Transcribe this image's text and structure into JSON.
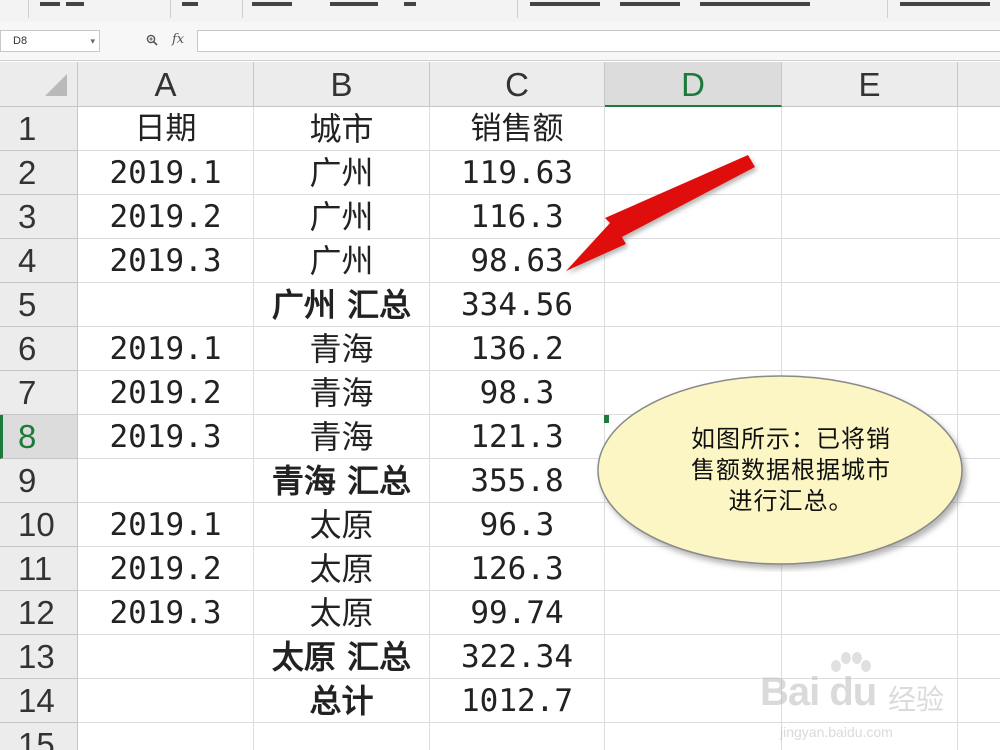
{
  "formula_bar": {
    "name_box": "D8",
    "fx": "fx",
    "formula": ""
  },
  "columns": [
    "A",
    "B",
    "C",
    "D",
    "E"
  ],
  "active_column": "D",
  "active_row": 8,
  "rows": [
    {
      "num": "1",
      "a": "日期",
      "b": "城市",
      "c": "销售额",
      "b_style": "city"
    },
    {
      "num": "2",
      "a": "2019.1",
      "b": "广州",
      "c": "119.63",
      "b_style": "city"
    },
    {
      "num": "3",
      "a": "2019.2",
      "b": "广州",
      "c": "116.3",
      "b_style": "city"
    },
    {
      "num": "4",
      "a": "2019.3",
      "b": "广州",
      "c": "98.63",
      "b_style": "city"
    },
    {
      "num": "5",
      "a": "",
      "b": "广州 汇总",
      "c": "334.56",
      "b_style": "subtotal"
    },
    {
      "num": "6",
      "a": "2019.1",
      "b": "青海",
      "c": "136.2",
      "b_style": "city"
    },
    {
      "num": "7",
      "a": "2019.2",
      "b": "青海",
      "c": "98.3",
      "b_style": "city"
    },
    {
      "num": "8",
      "a": "2019.3",
      "b": "青海",
      "c": "121.3",
      "b_style": "city"
    },
    {
      "num": "9",
      "a": "",
      "b": "青海 汇总",
      "c": "355.8",
      "b_style": "subtotal"
    },
    {
      "num": "10",
      "a": "2019.1",
      "b": "太原",
      "c": "96.3",
      "b_style": "city"
    },
    {
      "num": "11",
      "a": "2019.2",
      "b": "太原",
      "c": "126.3",
      "b_style": "city"
    },
    {
      "num": "12",
      "a": "2019.3",
      "b": "太原",
      "c": "99.74",
      "b_style": "city"
    },
    {
      "num": "13",
      "a": "",
      "b": "太原 汇总",
      "c": "322.34",
      "b_style": "subtotal"
    },
    {
      "num": "14",
      "a": "",
      "b": "总计",
      "c": "1012.7",
      "b_style": "subtotal"
    },
    {
      "num": "15",
      "a": "",
      "b": "",
      "c": "",
      "b_style": "city"
    }
  ],
  "callout": {
    "lines": [
      "如图所示：已将销",
      "售额数据根据城市",
      "进行汇总。"
    ],
    "fill": "#fbf6c4",
    "stroke": "#8a8a8a"
  },
  "arrow_color": "#e01010",
  "watermark": {
    "main": "Bai du",
    "cn": "经验",
    "sub": "jingyan.baidu.com"
  },
  "colors": {
    "accent_green": "#1e7a3c",
    "header_bg": "#ececec"
  }
}
